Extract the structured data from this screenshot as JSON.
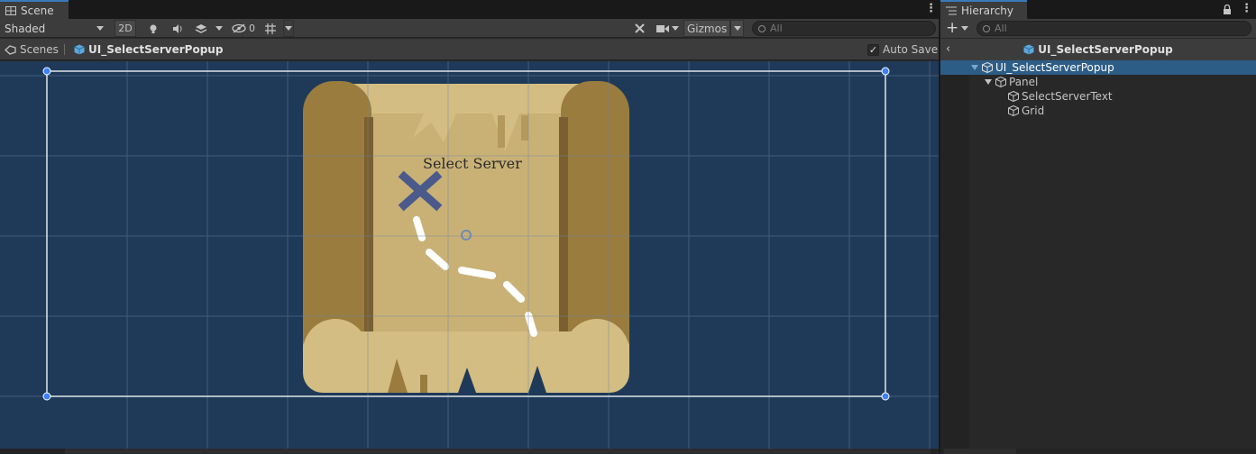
{
  "scene": {
    "tab_label": "Scene",
    "shading_mode": "Shaded",
    "btn_2d": "2D",
    "hidden_count": "0",
    "gizmos_label": "Gizmos",
    "search_placeholder": "All",
    "breadcrumb_root": "Scenes",
    "breadcrumb_prefab": "UI_SelectServerPopup",
    "auto_save_label": "Auto Save",
    "auto_save_checked": true,
    "popup_title": "Select Server"
  },
  "hierarchy": {
    "tab_label": "Hierarchy",
    "search_placeholder": "All",
    "header_title": "UI_SelectServerPopup",
    "items": [
      {
        "label": "UI_SelectServerPopup",
        "selected": true
      },
      {
        "label": "Panel",
        "selected": false
      },
      {
        "label": "SelectServerText",
        "selected": false
      },
      {
        "label": "Grid",
        "selected": false
      }
    ]
  },
  "colors": {
    "viewport_bg": "#1f3a59",
    "selection": "#2c5d87",
    "tab_accent": "#3a79bb",
    "map_parchment": "#d4bd82",
    "map_roll": "#9a7c3f",
    "map_x": "#4a5a8a"
  }
}
